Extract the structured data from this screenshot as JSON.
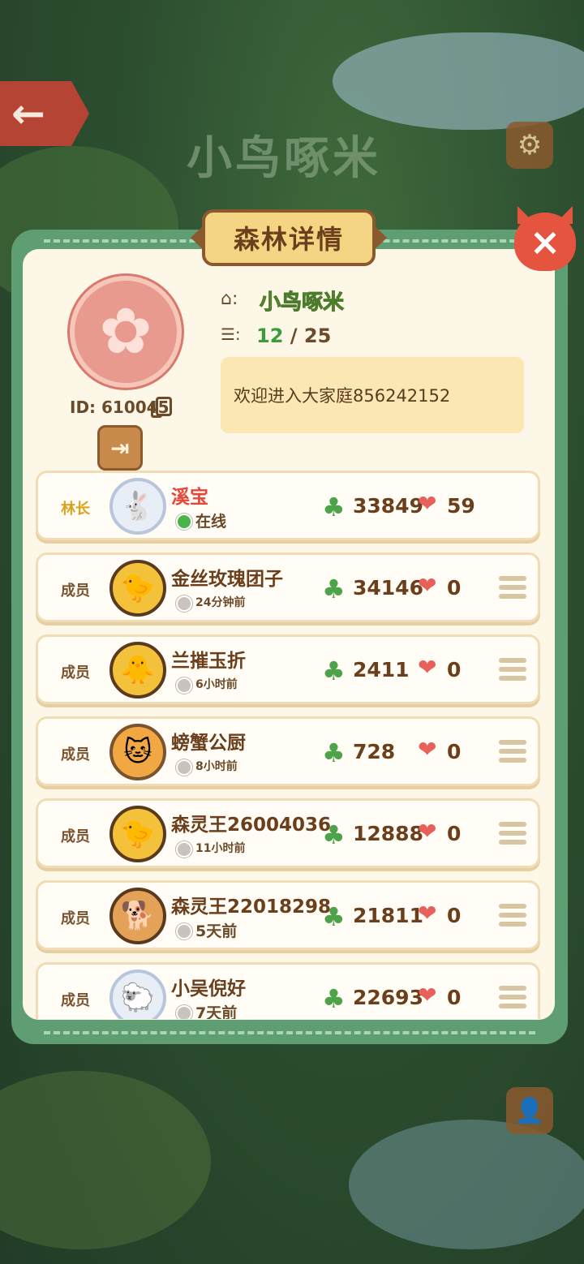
{
  "background": {
    "title": "小鸟啄米"
  },
  "modal": {
    "title": "森林详情",
    "close_icon": "×",
    "family": {
      "id_label": "ID: 610045",
      "name": "小鸟啄米",
      "count_current": "12",
      "count_sep": " / ",
      "count_max": "25",
      "notice": "欢迎进入大家庭856242152"
    },
    "members": [
      {
        "role": "林长",
        "name": "溪宝",
        "status": "在线",
        "score": "33849",
        "gifts": "59"
      },
      {
        "role": "成员",
        "name": "金丝玫瑰团子",
        "status": "24分钟前",
        "score": "34146",
        "gifts": "0"
      },
      {
        "role": "成员",
        "name": "兰摧玉折",
        "status": "6小时前",
        "score": "2411",
        "gifts": "0"
      },
      {
        "role": "成员",
        "name": "螃蟹公厨",
        "status": "8小时前",
        "score": "728",
        "gifts": "0"
      },
      {
        "role": "成员",
        "name": "森灵王26004036",
        "status": "11小时前",
        "score": "12888",
        "gifts": "0"
      },
      {
        "role": "成员",
        "name": "森灵王22018298",
        "status": "5天前",
        "score": "21811",
        "gifts": "0"
      },
      {
        "role": "成员",
        "name": "小吴倪好",
        "status": "7天前",
        "score": "22693",
        "gifts": "0"
      }
    ]
  },
  "colors": {
    "panel_green": "#5f9e73",
    "panel_cream": "#fdf7e8",
    "close_red": "#e4543f",
    "leader_gold": "#d9a21c",
    "online_green": "#48b44a"
  },
  "icons": [
    "back-arrow-icon",
    "settings-gear-icon",
    "close-icon",
    "home-icon",
    "members-icon",
    "copy-icon",
    "exit-icon",
    "clover-icon",
    "heart-letter-icon",
    "menu-icon",
    "profile-icon"
  ]
}
